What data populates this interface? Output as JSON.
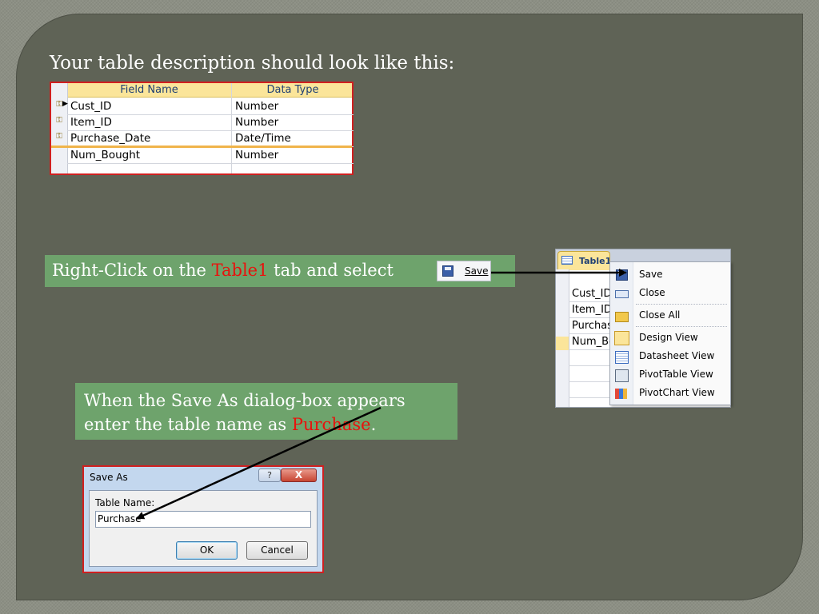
{
  "heading": "Your table description should look like this:",
  "field_table": {
    "columns": [
      "Field Name",
      "Data Type"
    ],
    "rows": [
      {
        "field": "Cust_ID",
        "type": "Number",
        "key": true
      },
      {
        "field": "Item_ID",
        "type": "Number",
        "key": true
      },
      {
        "field": "Purchase_Date",
        "type": "Date/Time",
        "key": true
      },
      {
        "field": "Num_Bought",
        "type": "Number",
        "key": false
      }
    ]
  },
  "instruction1": {
    "before": "Right-Click on the ",
    "highlight": "Table1",
    "after": " tab and select",
    "button_label": "Save"
  },
  "instruction2": {
    "before": "When the Save As dialog-box appears enter the table name as ",
    "highlight": "Purchase",
    "after": "."
  },
  "context_menu": {
    "tab_label": "Table1",
    "grid_rows": [
      "Cust_ID",
      "Item_ID",
      "Purchase_Date",
      "Num_Bought"
    ],
    "items": [
      {
        "label": "Save",
        "icon": "save-icon"
      },
      {
        "label": "Close",
        "icon": "close-table-icon"
      },
      {
        "label": "Close All",
        "icon": "folder-icon"
      },
      {
        "label": "Design View",
        "icon": "design-view-icon"
      },
      {
        "label": "Datasheet View",
        "icon": "datasheet-icon"
      },
      {
        "label": "PivotTable View",
        "icon": "pivot-table-icon"
      },
      {
        "label": "PivotChart View",
        "icon": "pivot-chart-icon"
      }
    ]
  },
  "save_dialog": {
    "title": "Save As",
    "help_glyph": "?",
    "close_glyph": "X",
    "label": "Table Name:",
    "value": "Purchase",
    "ok": "OK",
    "cancel": "Cancel"
  },
  "colors": {
    "slide_bg": "#5f6356",
    "instruction_bg": "#6ea36c",
    "highlight_red": "#e8120d",
    "table_header": "#fbe59a"
  }
}
